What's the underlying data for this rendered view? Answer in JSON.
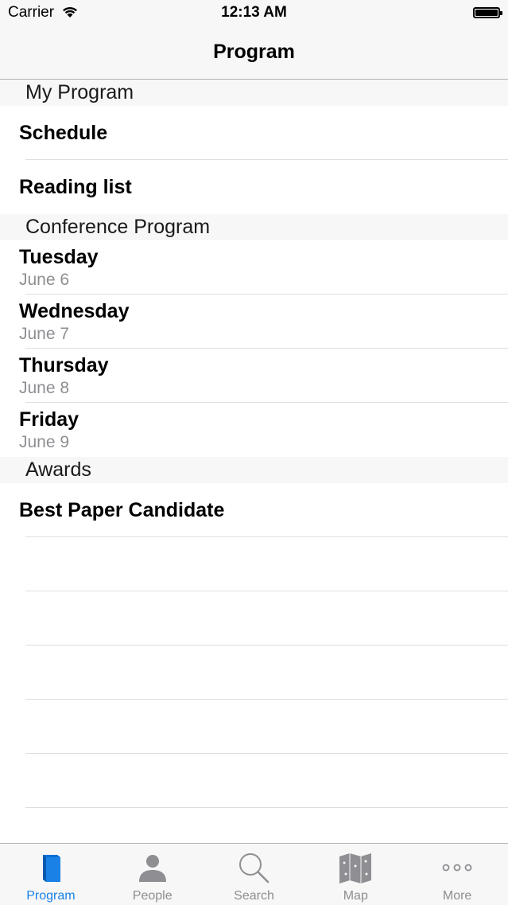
{
  "status": {
    "carrier": "Carrier",
    "time": "12:13 AM"
  },
  "nav": {
    "title": "Program"
  },
  "sections": [
    {
      "header": "My Program",
      "rows": [
        {
          "title": "Schedule"
        },
        {
          "title": "Reading list"
        }
      ]
    },
    {
      "header": "Conference Program",
      "rows": [
        {
          "title": "Tuesday",
          "subtitle": "June 6"
        },
        {
          "title": "Wednesday",
          "subtitle": "June 7"
        },
        {
          "title": "Thursday",
          "subtitle": "June 8"
        },
        {
          "title": "Friday",
          "subtitle": "June 9"
        }
      ]
    },
    {
      "header": "Awards",
      "rows": [
        {
          "title": "Best Paper Candidate"
        }
      ]
    }
  ],
  "tabs": [
    {
      "label": "Program",
      "icon": "book-icon",
      "active": true
    },
    {
      "label": "People",
      "icon": "person-icon",
      "active": false
    },
    {
      "label": "Search",
      "icon": "magnifier-icon",
      "active": false
    },
    {
      "label": "Map",
      "icon": "map-icon",
      "active": false
    },
    {
      "label": "More",
      "icon": "more-dots-icon",
      "active": false
    }
  ],
  "colors": {
    "accent": "#1a82e6",
    "inactive": "#8e8e93",
    "bar_bg": "#f7f7f7"
  }
}
